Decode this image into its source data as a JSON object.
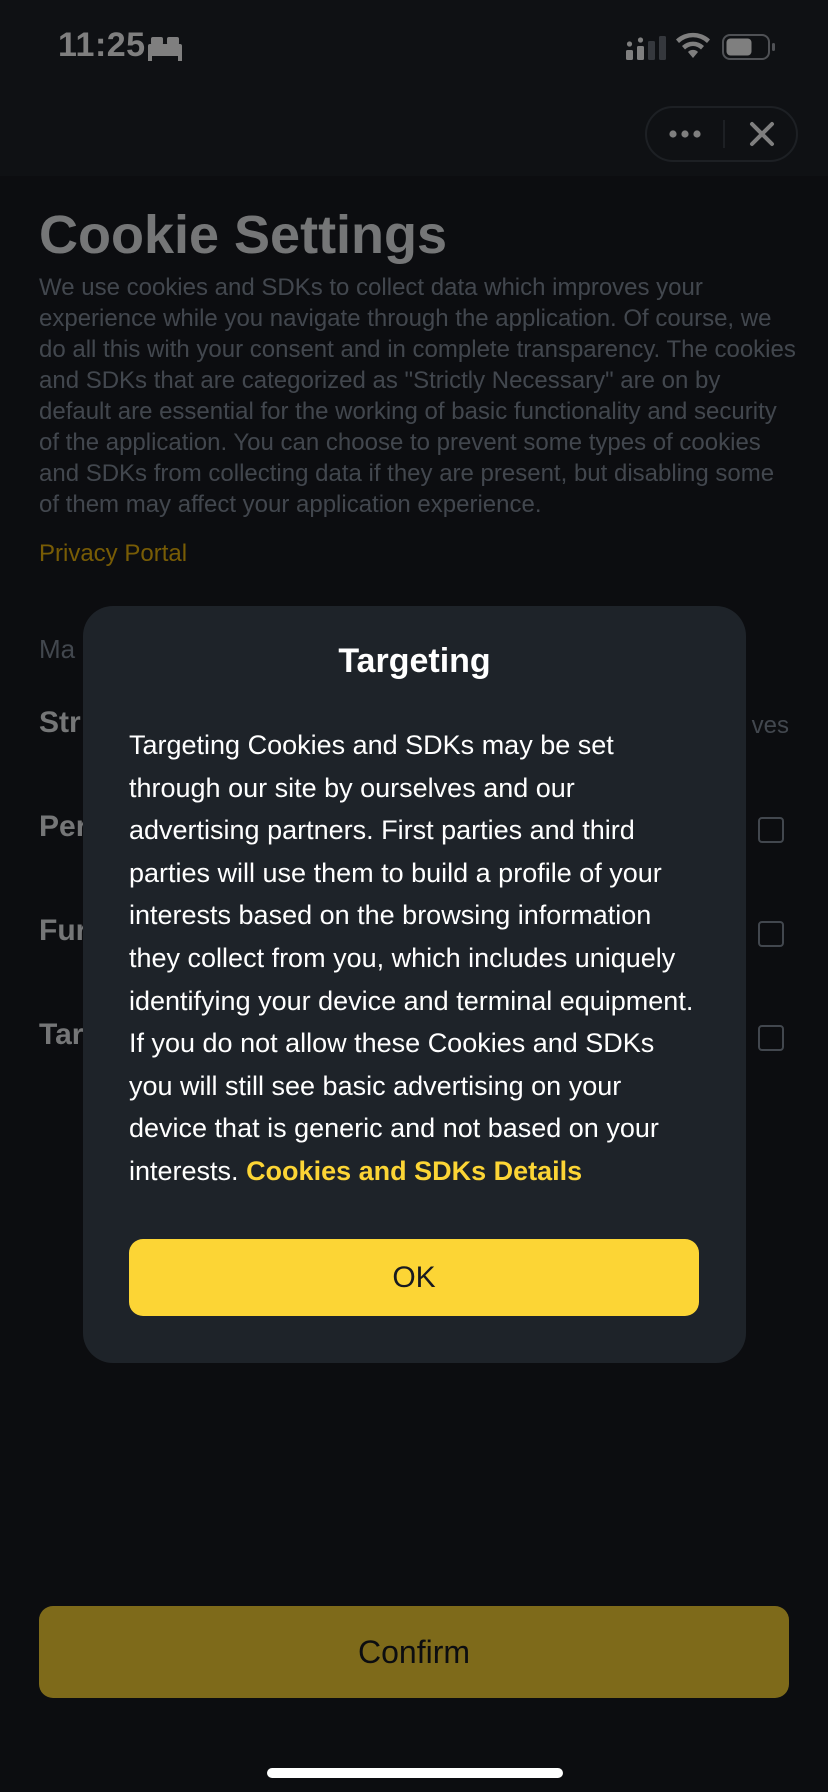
{
  "status_bar": {
    "time": "11:25"
  },
  "header": {},
  "page": {
    "title": "Cookie Settings",
    "description": "We use cookies and SDKs to collect data which improves your experience while you navigate through the application. Of course, we do all this with your consent and in complete transparency. The cookies and SDKs that are categorized as \"Strictly Necessary\" are on by default are essential for the working of basic functionality and security of the application. You can choose to prevent some types of cookies and SDKs from collecting data if they are present, but disabling some of them may affect your application experience.",
    "privacy_link": "Privacy Portal",
    "confirm_label": "Confirm"
  },
  "modal": {
    "title": "Targeting",
    "body": "Targeting Cookies and SDKs may be set through our site by ourselves and our advertising partners. First parties and third parties will use them to build a profile of your interests based on the browsing information they collect from you, which includes uniquely identifying your device and terminal equipment. If you do not allow these Cookies and SDKs you will still see basic advertising on your device that is generic and not based on your interests.",
    "link": "Cookies and SDKs Details",
    "ok_label": "OK"
  },
  "colors": {
    "accent": "#fcd535",
    "link": "#f0b90b",
    "background": "#181a20",
    "surface": "#1e2329"
  },
  "icons": [
    "bed-icon",
    "signal-icon",
    "wifi-icon",
    "battery-icon",
    "more-icon",
    "close-icon"
  ]
}
